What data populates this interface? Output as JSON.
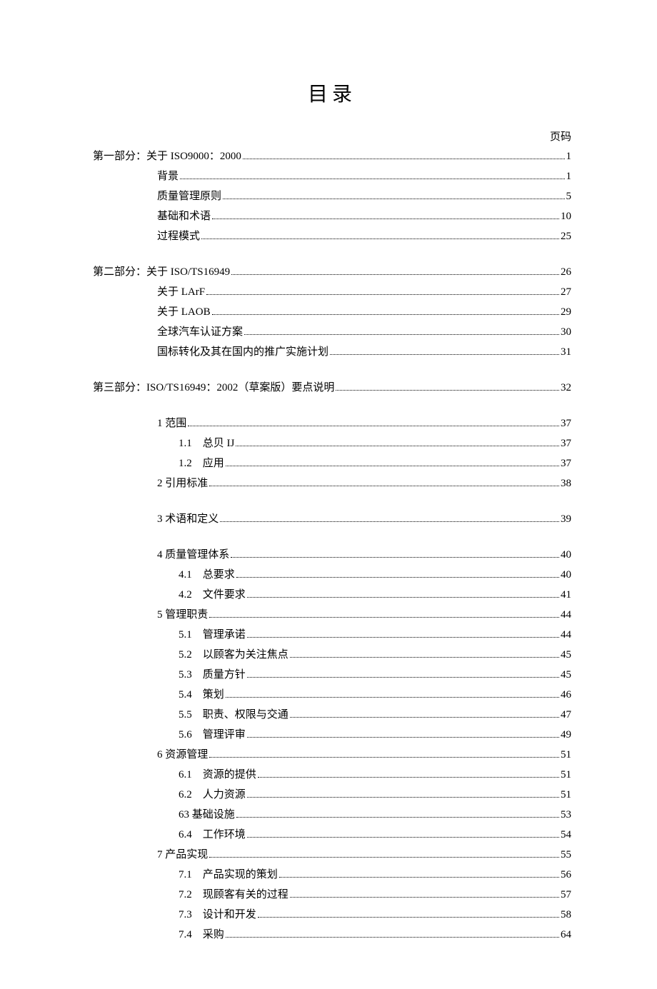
{
  "title": "目录",
  "page_header": "页码",
  "entries": [
    {
      "indent": 0,
      "label": "第一部分：关于 ISO9000：2000",
      "page": "1"
    },
    {
      "indent": 1,
      "label": "背景",
      "page": "1"
    },
    {
      "indent": 1,
      "label": "质量管理原则",
      "page": "5"
    },
    {
      "indent": 1,
      "label": "基础和术语",
      "page": "10"
    },
    {
      "indent": 1,
      "label": "过程模式",
      "page": "25"
    },
    {
      "gap": "sm"
    },
    {
      "indent": 0,
      "label": "第二部分：关于 ISO/TS16949",
      "page": "26"
    },
    {
      "indent": 1,
      "label": "关于 LArF",
      "page": "27"
    },
    {
      "indent": 1,
      "label": "关于 LAOB",
      "page": "29"
    },
    {
      "indent": 1,
      "label": "全球汽车认证方案",
      "page": "30"
    },
    {
      "indent": 1,
      "label": "国标转化及其在国内的推广实施计划",
      "page": "31"
    },
    {
      "gap": "sm"
    },
    {
      "indent": 0,
      "label": "第三部分：ISO/TS16949：2002（草案版）要点说明",
      "page": "32"
    },
    {
      "gap": "sm"
    },
    {
      "indent": 1,
      "label": "1 范围",
      "page": "37"
    },
    {
      "indent": 2,
      "label": "1.1　总贝 IJ",
      "page": "37"
    },
    {
      "indent": 2,
      "label": "1.2　应用",
      "page": "37"
    },
    {
      "indent": 1,
      "label": "2 引用标准",
      "page": "38"
    },
    {
      "gap": "sm"
    },
    {
      "indent": 1,
      "label": "3 术语和定义",
      "page": "39"
    },
    {
      "gap": "sm"
    },
    {
      "indent": 1,
      "label": "4 质量管理体系",
      "page": "40"
    },
    {
      "indent": 2,
      "label": "4.1　总要求",
      "page": "40"
    },
    {
      "indent": 2,
      "label": "4.2　文件要求",
      "page": "41"
    },
    {
      "indent": 1,
      "label": "5 管理职责",
      "page": "44"
    },
    {
      "indent": 2,
      "label": "5.1　管理承诺",
      "page": "44"
    },
    {
      "indent": 2,
      "label": "5.2　以顾客为关注焦点",
      "page": "45"
    },
    {
      "indent": 2,
      "label": "5.3　质量方针",
      "page": "45"
    },
    {
      "indent": 2,
      "label": "5.4　策划",
      "page": "46"
    },
    {
      "indent": 2,
      "label": "5.5　职责、权限与交通",
      "page": "47"
    },
    {
      "indent": 2,
      "label": "5.6　管理评审",
      "page": "49"
    },
    {
      "indent": 1,
      "label": "6 资源管理",
      "page": "51"
    },
    {
      "indent": 2,
      "label": "6.1　资源的提供",
      "page": "51"
    },
    {
      "indent": 2,
      "label": "6.2　人力资源",
      "page": "51"
    },
    {
      "indent": 2,
      "label": "63 基础设施",
      "page": "53"
    },
    {
      "indent": 2,
      "label": "6.4　工作环境",
      "page": "54"
    },
    {
      "indent": 1,
      "label": "7 产品实现",
      "page": "55"
    },
    {
      "indent": 2,
      "label": "7.1　产品实现的策划",
      "page": "56"
    },
    {
      "indent": 2,
      "label": "7.2　现顾客有关的过程",
      "page": "57"
    },
    {
      "indent": 2,
      "label": "7.3　设计和开发",
      "page": "58"
    },
    {
      "indent": 2,
      "label": "7.4　采购",
      "page": "64"
    }
  ]
}
